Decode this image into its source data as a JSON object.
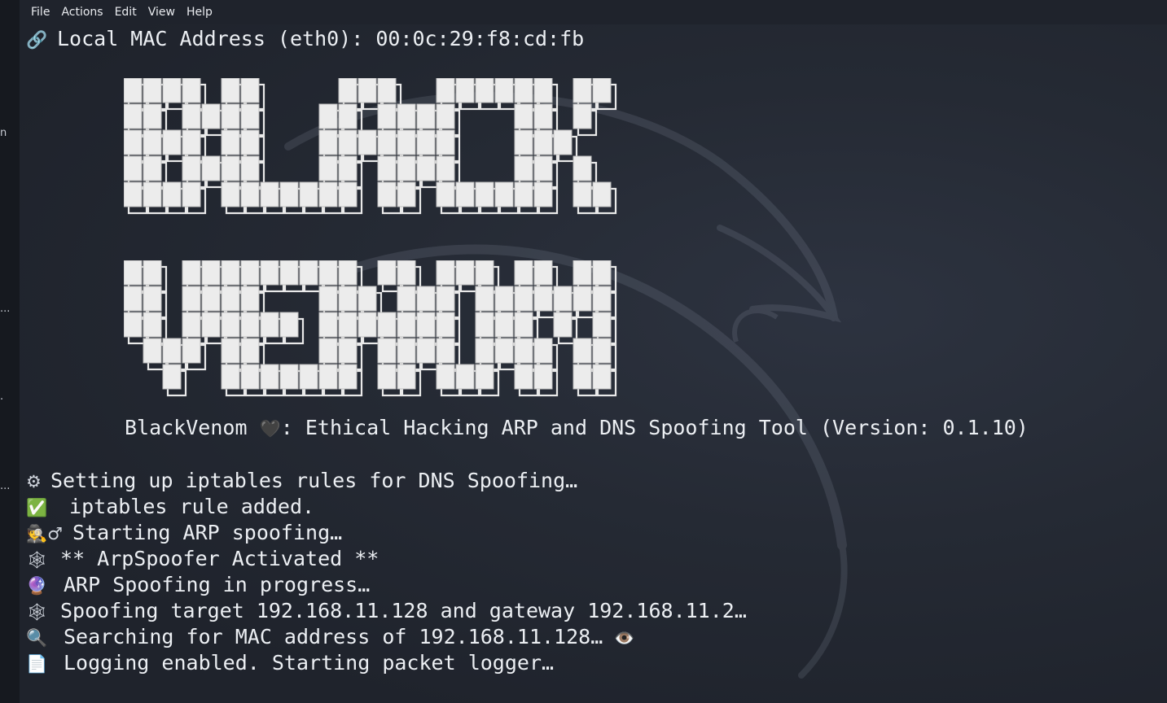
{
  "menubar": {
    "items": [
      "File",
      "Actions",
      "Edit",
      "View",
      "Help"
    ]
  },
  "left_fragments": [
    "n",
    "...",
    ".",
    "..."
  ],
  "terminal": {
    "mac_line": {
      "icon": "link-icon",
      "text": "Local MAC Address (eth0): 00:0c:29:f8:cd:fb"
    },
    "banner": {
      "line1": "BLACK",
      "line2": "VENOM",
      "color": "#ececec"
    },
    "tagline": {
      "name": "BlackVenom",
      "heart": "🖤",
      "text": ": Ethical Hacking ARP and DNS Spoofing Tool (Version: 0.1.10)"
    },
    "log": [
      {
        "icon": "gear-icon",
        "glyph": "⚙",
        "text": "Setting up iptables rules for DNS Spoofing…"
      },
      {
        "icon": "check-icon",
        "glyph": "✅",
        "text": " iptables rule added."
      },
      {
        "icon": "detective-icon",
        "glyph": "🕵♂",
        "text": " Starting ARP spoofing…"
      },
      {
        "icon": "spider-web-icon",
        "glyph": "🕸",
        "text": "** ArpSpoofer Activated **"
      },
      {
        "icon": "crystal-ball-icon",
        "glyph": "🔮",
        "text": "ARP Spoofing in progress…"
      },
      {
        "icon": "spider-web-icon",
        "glyph": "🕸",
        "text": "Spoofing target 192.168.11.128 and gateway 192.168.11.2…"
      },
      {
        "icon": "magnifier-icon",
        "glyph": "🔍",
        "text": "Searching for MAC address of 192.168.11.128…",
        "suffix": "👁️"
      },
      {
        "icon": "document-icon",
        "glyph": "📄",
        "text": "Logging enabled. Starting packet logger…"
      }
    ]
  },
  "colors": {
    "background": "#1f232c",
    "text": "#eceff3"
  }
}
